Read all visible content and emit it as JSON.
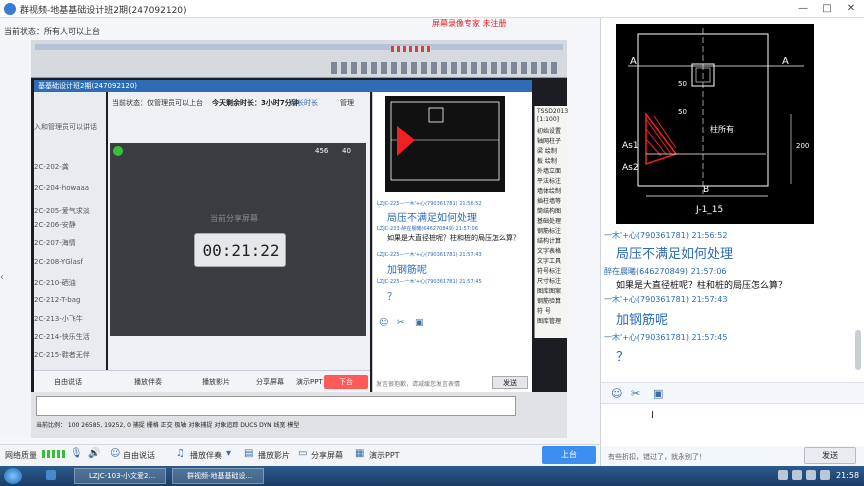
{
  "window": {
    "title": "群视频-地基基础设计班2期(247092120)",
    "recorder_watermark": "屏幕录像专家  未注册",
    "controls": [
      "—",
      "□",
      "✕"
    ]
  },
  "status": {
    "text": "当前状态：所有人可以上台"
  },
  "inner_window": {
    "title": "基基础设计班2期(247092120)",
    "status": "当前状态：仅管理员可以上台",
    "remaining": "今天剩余时长：3小时7分钟",
    "extend": "延长时长",
    "manage": "管理",
    "count_viewers": "456",
    "count_mic": "40",
    "screen_placeholder": "当前分享屏幕",
    "timer": "00:21:22",
    "toolbar": [
      "自由说话",
      "播放伴奏",
      "播放影片",
      "分享屏幕",
      "演示PPT"
    ],
    "stop": "下台",
    "input_hint": "发言很抱歉，请减缓您发言表情",
    "send": "发送",
    "member_list": [
      "入和管理员可以讲话",
      "2C-202-龚",
      "2C-204-howaaa",
      "2C-205-爱气求淡",
      "2C-206-安静",
      "2C-207-海情",
      "2C-208-YGlasf",
      "2C-210-硒油",
      "2C-212-T-bag",
      "2C-213-小飞牛",
      "2C-214-快乐生活",
      "2C-215-鞋者无伴"
    ],
    "chat": [
      {
        "head": "LZJC-225—一木'+心(790361781)  21:56:52",
        "text": "局压不满足如何处理",
        "big": true
      },
      {
        "head": "LZJC-233-醉在晨曦(646270849)  21:57:06",
        "text": "如果是大直径桩呢？柱和桩的局压怎么算？",
        "big": false
      },
      {
        "head": "LZJC-225—一木'+心(790361781)  21:57:43",
        "text": "加钢筋呢",
        "big": true
      },
      {
        "head": "LZJC-225—一木'+心(790361781)  21:57:45",
        "text": "？",
        "big": true
      }
    ]
  },
  "cad": {
    "menu": [
      "TSSD2013",
      "[1:100]",
      "初始设置",
      "轴网柱子",
      "梁 绘制",
      "板 绘制",
      "外墙立面",
      "平法标注",
      "墙体绘制",
      "插柱墙等",
      "筒结构图",
      "基础处理",
      "钢筋标注",
      "结构计算",
      "文字表格",
      "文字工具",
      "符号标注",
      "尺寸标注",
      "图库图案",
      "钢筋验算",
      "符 号",
      "图库管理"
    ],
    "coords": "当前比例： 100  26585, 19252, 0     捕捉 栅格 正交 极轴 对象捕捉 对象追踪 DUCS DYN 线宽 模型"
  },
  "bottom_toolbar": {
    "network": "网络质量",
    "free_talk": "自由说话",
    "music": "播放伴奏",
    "movie": "播放影片",
    "share": "分享屏幕",
    "ppt": "演示PPT",
    "onstage": "上台"
  },
  "chat": {
    "drawing_labels": [
      "A",
      "A",
      "As1",
      "As2",
      "B",
      "J-1_15",
      "柱所有",
      "50",
      "50",
      "200"
    ],
    "messages": [
      {
        "head": "一木'+心(790361781)  21:56:52",
        "text": "局压不满足如何处理",
        "style": "big",
        "head_color": "blue"
      },
      {
        "head": "醉在晨曦(646270849)  21:57:06",
        "text": "如果是大直径桩呢？柱和桩的局压怎么算？",
        "style": "normal",
        "head_color": "blue"
      },
      {
        "head": "一木'+心(790361781)  21:57:43",
        "text": "加钢筋呢",
        "style": "big",
        "head_color": "blue"
      },
      {
        "head": "一木'+心(790361781)  21:57:45",
        "text": "？",
        "style": "big",
        "head_color": "blue"
      }
    ],
    "input_placeholder": "有些折扣，错过了，就永别了！",
    "send": "发送",
    "tools": [
      "smile-icon",
      "scissors-icon",
      "image-icon"
    ]
  },
  "taskbar": {
    "tasks": [
      "LZJC-103-小文爱2...",
      "群视频-地基基础设..."
    ],
    "clock": "21:58"
  }
}
